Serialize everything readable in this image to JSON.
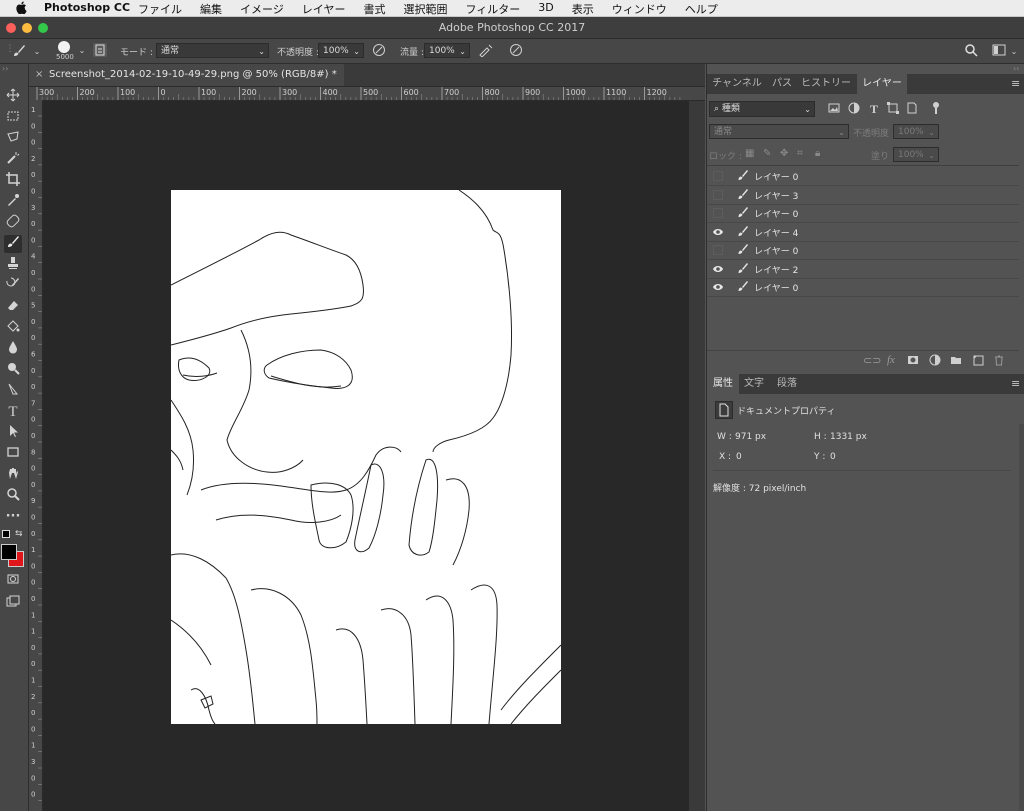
{
  "menubar": {
    "apple": "",
    "app_name": "Photoshop CC",
    "items": [
      "ファイル",
      "編集",
      "イメージ",
      "レイヤー",
      "書式",
      "選択範囲",
      "フィルター",
      "3D",
      "表示",
      "ウィンドウ",
      "ヘルプ"
    ]
  },
  "window": {
    "title": "Adobe Photoshop CC 2017"
  },
  "options": {
    "brush_size": "5000",
    "mode_label": "モード :",
    "mode_value": "通常",
    "opacity_label": "不透明度 :",
    "opacity_value": "100%",
    "flow_label": "流量 :",
    "flow_value": "100%"
  },
  "document": {
    "tab_title": "Screenshot_2014-02-19-10-49-29.png @ 50% (RGB/8#) *",
    "close": "×",
    "ruler_top": [
      "300",
      "200",
      "100",
      "0",
      "100",
      "200",
      "300",
      "400",
      "500",
      "600",
      "700",
      "800",
      "900",
      "1000",
      "1100",
      "1200"
    ],
    "ruler_left": [
      "1",
      "0",
      "0",
      "2",
      "0",
      "0",
      "3",
      "0",
      "0",
      "4",
      "0",
      "0",
      "5",
      "0",
      "0",
      "6",
      "0",
      "0",
      "7",
      "0",
      "0",
      "8",
      "0",
      "0",
      "9",
      "0",
      "0",
      "1",
      "0",
      "0",
      "0",
      "1",
      "1",
      "0",
      "0",
      "1",
      "2",
      "0",
      "0",
      "1",
      "3",
      "0",
      "0"
    ]
  },
  "layers_panel": {
    "tabs": [
      "チャンネル",
      "パス",
      "ヒストリー",
      "レイヤー"
    ],
    "active_tab": "レイヤー",
    "filter_label": "種類",
    "blend_mode": "通常",
    "opacity_label": "不透明度 :",
    "opacity_value": "100%",
    "lock_label": "ロック :",
    "fill_label": "塗り :",
    "fill_value": "100%",
    "layers": [
      {
        "name": "レイヤー 0",
        "visible": false
      },
      {
        "name": "レイヤー 3",
        "visible": false
      },
      {
        "name": "レイヤー 0",
        "visible": false
      },
      {
        "name": "レイヤー 4",
        "visible": true
      },
      {
        "name": "レイヤー 0",
        "visible": false
      },
      {
        "name": "レイヤー 2",
        "visible": true
      },
      {
        "name": "レイヤー 0",
        "visible": true
      }
    ]
  },
  "properties_panel": {
    "tabs": [
      "属性",
      "文字",
      "段落"
    ],
    "active_tab": "属性",
    "section": "ドキュメントプロパティ",
    "w_label": "W :",
    "w_value": "971 px",
    "h_label": "H :",
    "h_value": "1331 px",
    "x_label": "X :",
    "x_value": "0",
    "y_label": "Y :",
    "y_value": "0",
    "resolution": "解像度 : 72 pixel/inch"
  },
  "colors": {
    "foreground": "#000000",
    "background": "#e0161b",
    "close_light": "#fc605b",
    "min_light": "#fdbc40",
    "max_light": "#34c84a"
  }
}
